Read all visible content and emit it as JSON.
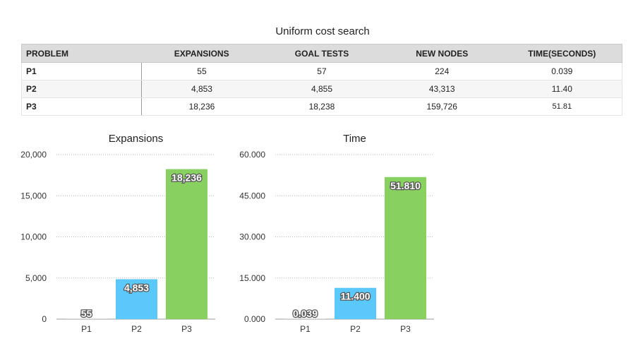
{
  "table": {
    "title": "Uniform cost search",
    "headers": [
      "PROBLEM",
      "EXPANSIONS",
      "GOAL TESTS",
      "NEW NODES",
      "TIME(SECONDS)"
    ],
    "rows": [
      [
        "P1",
        "55",
        "57",
        "224",
        "0.039"
      ],
      [
        "P2",
        "4,853",
        "4,855",
        "43,313",
        "11.40"
      ],
      [
        "P3",
        "18,236",
        "18,238",
        "159,726",
        "51.81"
      ]
    ]
  },
  "chart_data": [
    {
      "type": "bar",
      "title": "Expansions",
      "categories": [
        "P1",
        "P2",
        "P3"
      ],
      "values": [
        55,
        4853,
        18236
      ],
      "value_labels": [
        "55",
        "4,853",
        "18,236"
      ],
      "colors": [
        "#c8c8c8",
        "#5ac8fa",
        "#88d05f"
      ],
      "ylim": [
        0,
        20000
      ],
      "yticks": [
        "0",
        "5,000",
        "10,000",
        "15,000",
        "20,000"
      ],
      "grid": true
    },
    {
      "type": "bar",
      "title": "Time",
      "categories": [
        "P1",
        "P2",
        "P3"
      ],
      "values": [
        0.039,
        11.4,
        51.81
      ],
      "value_labels": [
        "0.039",
        "11.400",
        "51.810"
      ],
      "colors": [
        "#c8c8c8",
        "#5ac8fa",
        "#88d05f"
      ],
      "ylim": [
        0,
        60
      ],
      "yticks": [
        "0.000",
        "15.000",
        "30.000",
        "45.000",
        "60.000"
      ],
      "grid": true
    }
  ]
}
